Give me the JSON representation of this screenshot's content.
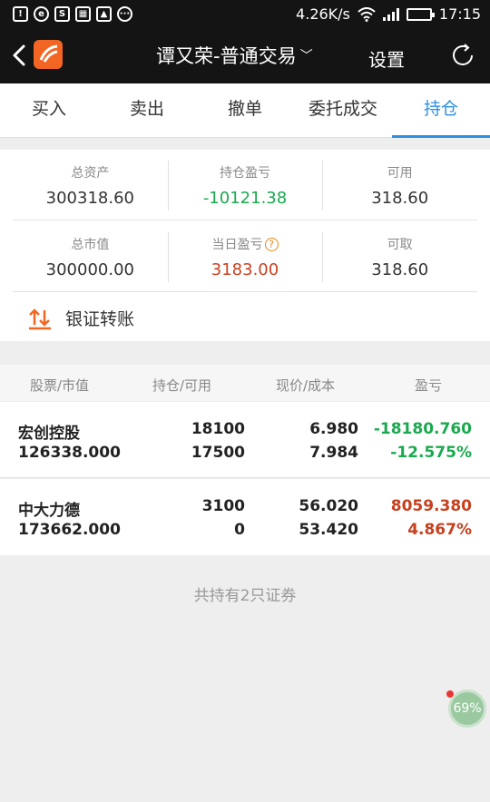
{
  "status_bar": {
    "speed": "4.26K/s",
    "time": "17:15"
  },
  "header": {
    "title": "谭又荣-普通交易",
    "settings_label": "设置"
  },
  "tabs": [
    {
      "label": "买入"
    },
    {
      "label": "卖出"
    },
    {
      "label": "撤单"
    },
    {
      "label": "委托成交"
    },
    {
      "label": "持仓"
    }
  ],
  "summary": {
    "total_assets": {
      "label": "总资产",
      "value": "300318.60"
    },
    "position_pnl": {
      "label": "持仓盈亏",
      "value": "-10121.38"
    },
    "available": {
      "label": "可用",
      "value": "318.60"
    },
    "market_value": {
      "label": "总市值",
      "value": "300000.00"
    },
    "daily_pnl": {
      "label": "当日盈亏",
      "value": "3183.00"
    },
    "withdrawable": {
      "label": "可取",
      "value": "318.60"
    },
    "transfer_label": "银证转账"
  },
  "holdings": {
    "columns": [
      "股票/市值",
      "持仓/可用",
      "现价/成本",
      "盈亏"
    ],
    "rows": [
      {
        "name": "宏创控股",
        "market_value": "126338.000",
        "position": "18100",
        "available": "17500",
        "price": "6.980",
        "cost": "7.984",
        "pnl": "-18180.760",
        "pnl_pct": "-12.575%"
      },
      {
        "name": "中大力德",
        "market_value": "173662.000",
        "position": "3100",
        "available": "0",
        "price": "56.020",
        "cost": "53.420",
        "pnl": "8059.380",
        "pnl_pct": "4.867%"
      }
    ],
    "footer": "共持有2只证券"
  },
  "floating_badge": "69%",
  "colors": {
    "accent": "#2e8fe0",
    "gain": "#c8401e",
    "loss": "#1aa94f",
    "brand": "#f26522"
  }
}
